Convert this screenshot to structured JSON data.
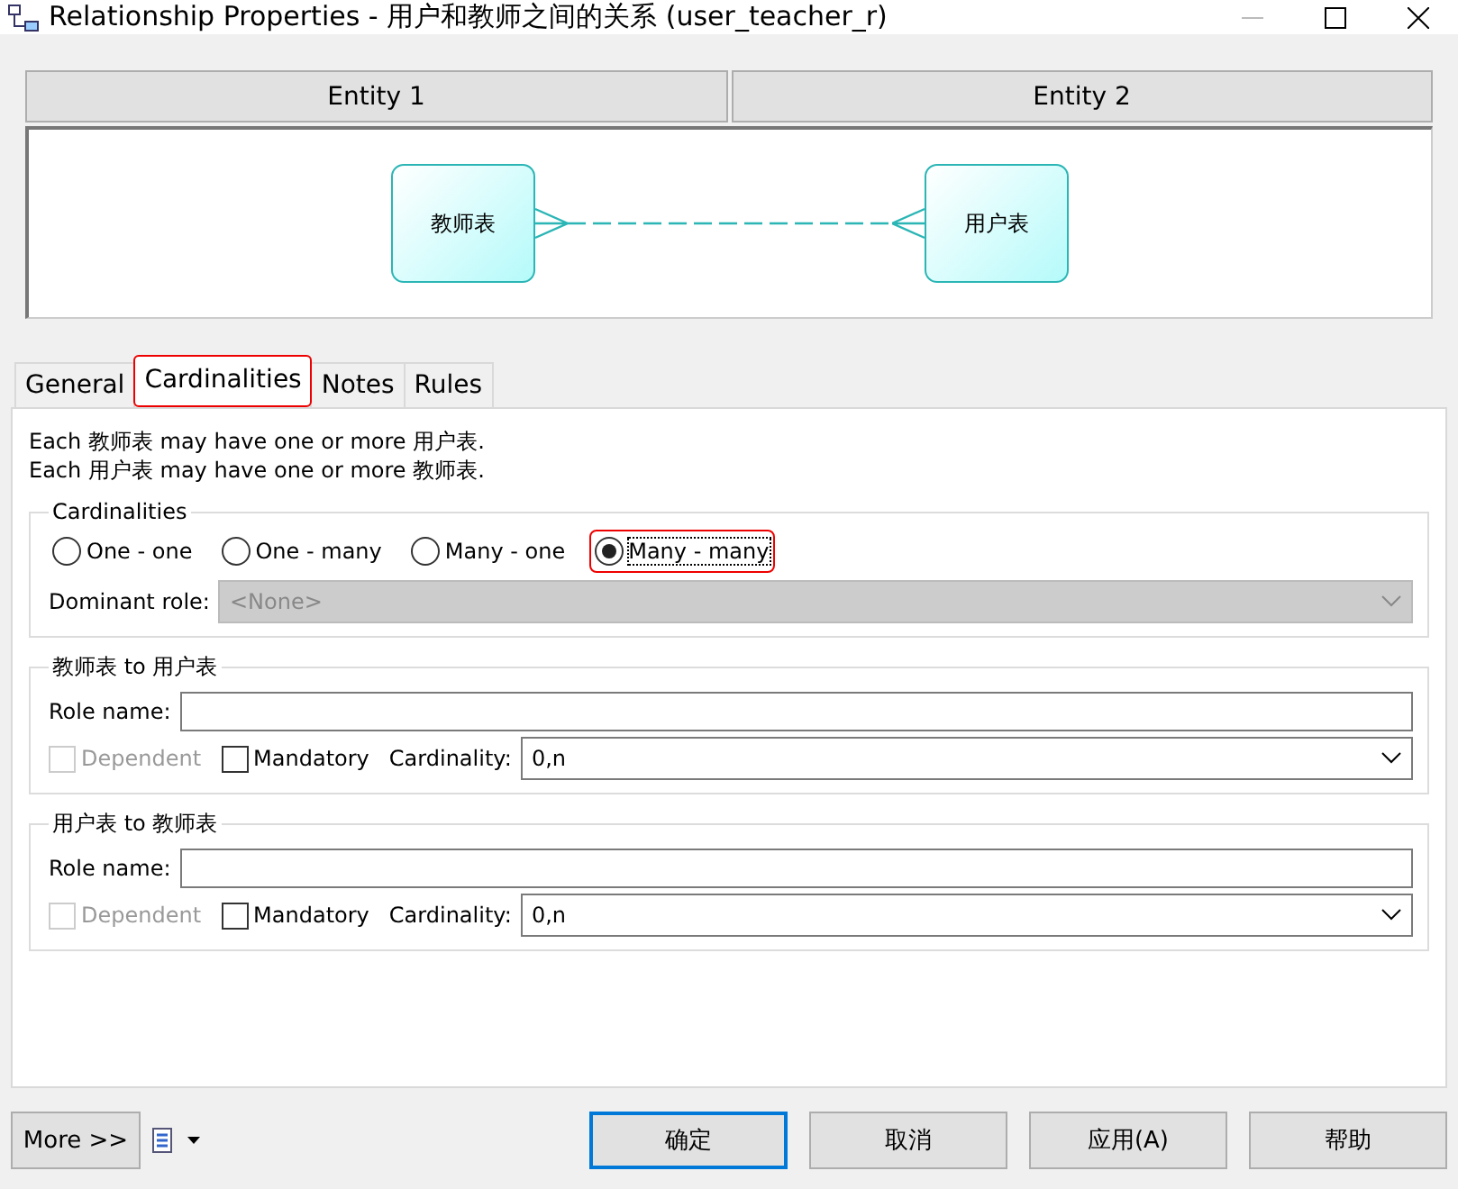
{
  "window": {
    "title": "Relationship Properties - 用户和教师之间的关系 (user_teacher_r)"
  },
  "entity_headers": [
    "Entity 1",
    "Entity 2"
  ],
  "diagram": {
    "entity_1": "教师表",
    "entity_2": "用户表"
  },
  "tabs": [
    {
      "label": "General",
      "selected": false,
      "highlighted": false
    },
    {
      "label": "Cardinalities",
      "selected": true,
      "highlighted": true
    },
    {
      "label": "Notes",
      "selected": false,
      "highlighted": false
    },
    {
      "label": "Rules",
      "selected": false,
      "highlighted": false
    }
  ],
  "description": [
    "Each 教师表 may have one or more 用户表.",
    "Each 用户表 may have one or more 教师表."
  ],
  "cardinalities": {
    "legend": "Cardinalities",
    "options": [
      {
        "label": "One - one",
        "selected": false,
        "highlighted": false
      },
      {
        "label": "One - many",
        "selected": false,
        "highlighted": false
      },
      {
        "label": "Many - one",
        "selected": false,
        "highlighted": false
      },
      {
        "label": "Many - many",
        "selected": true,
        "highlighted": true
      }
    ],
    "dominant_role": {
      "label": "Dominant role:",
      "value": "<None>",
      "disabled": true
    }
  },
  "roles": [
    {
      "legend": "教师表 to 用户表",
      "role_name_label": "Role name:",
      "dependent": {
        "label": "Dependent",
        "checked": false,
        "disabled": true
      },
      "mandatory": {
        "label": "Mandatory",
        "checked": false,
        "disabled": false
      },
      "cardinality_label": "Cardinality:",
      "cardinality": "0,n"
    },
    {
      "legend": "用户表 to 教师表",
      "role_name_label": "Role name:",
      "dependent": {
        "label": "Dependent",
        "checked": false,
        "disabled": true
      },
      "mandatory": {
        "label": "Mandatory",
        "checked": false,
        "disabled": false
      },
      "cardinality_label": "Cardinality:",
      "cardinality": "0,n"
    }
  ],
  "more_button": "More >>",
  "buttons": [
    {
      "label": "确定",
      "selected": true
    },
    {
      "label": "取消",
      "selected": false
    },
    {
      "label": "应用(A)",
      "selected": false
    },
    {
      "label": "帮助",
      "selected": false
    }
  ]
}
